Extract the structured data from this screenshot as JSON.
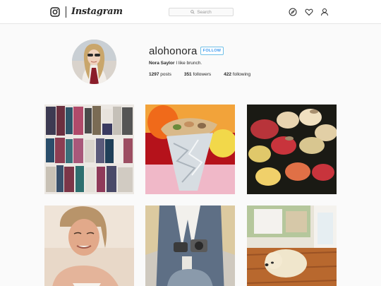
{
  "nav": {
    "brand": "Instagram",
    "search_placeholder": "Search",
    "icons": [
      "instagram-logo-icon",
      "compass-icon",
      "heart-icon",
      "user-icon"
    ]
  },
  "profile": {
    "username": "alohonora",
    "follow_label": "FOLLOW",
    "full_name": "Nora Saylor",
    "bio": "I like brunch.",
    "posts_count": "1297",
    "posts_label": "posts",
    "followers_count": "351",
    "followers_label": "followers",
    "following_count": "422",
    "following_label": "following"
  },
  "posts": [
    {
      "subject": "folded clothes"
    },
    {
      "subject": "burrito"
    },
    {
      "subject": "sushi"
    },
    {
      "subject": "woman on beach"
    },
    {
      "subject": "person with camera"
    },
    {
      "subject": "dog on floor"
    }
  ],
  "colors": {
    "accent": "#3897f0",
    "border": "#dbdbdb",
    "background": "#fafafa",
    "text": "#262626"
  }
}
